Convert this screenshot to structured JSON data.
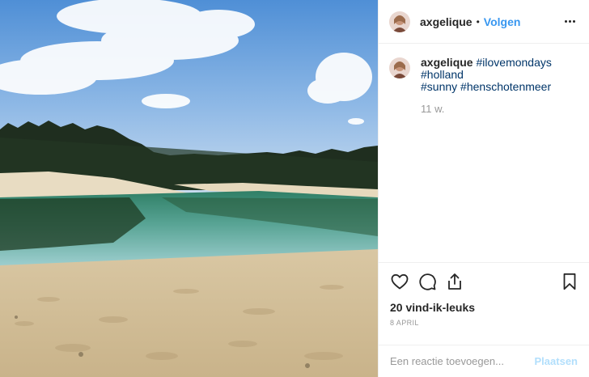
{
  "post": {
    "username": "axgelique",
    "follow_label": "Volgen",
    "separator": "•",
    "caption": {
      "username": "axgelique",
      "hashtags": [
        "#ilovemondays",
        "#holland",
        "#sunny",
        "#henschotenmeer"
      ]
    },
    "time_ago": "11 w.",
    "likes": "20 vind-ik-leuks",
    "date": "8 april",
    "comment_placeholder": "Een reactie toevoegen...",
    "post_button": "Plaatsen"
  },
  "icons": {
    "more": "more-horizontal-icon",
    "like": "heart-icon",
    "comment": "comment-icon",
    "share": "share-icon",
    "save": "bookmark-icon"
  },
  "colors": {
    "link": "#3897f0",
    "hashtag": "#003569",
    "muted": "#999999",
    "post_disabled": "#b2dffc"
  }
}
